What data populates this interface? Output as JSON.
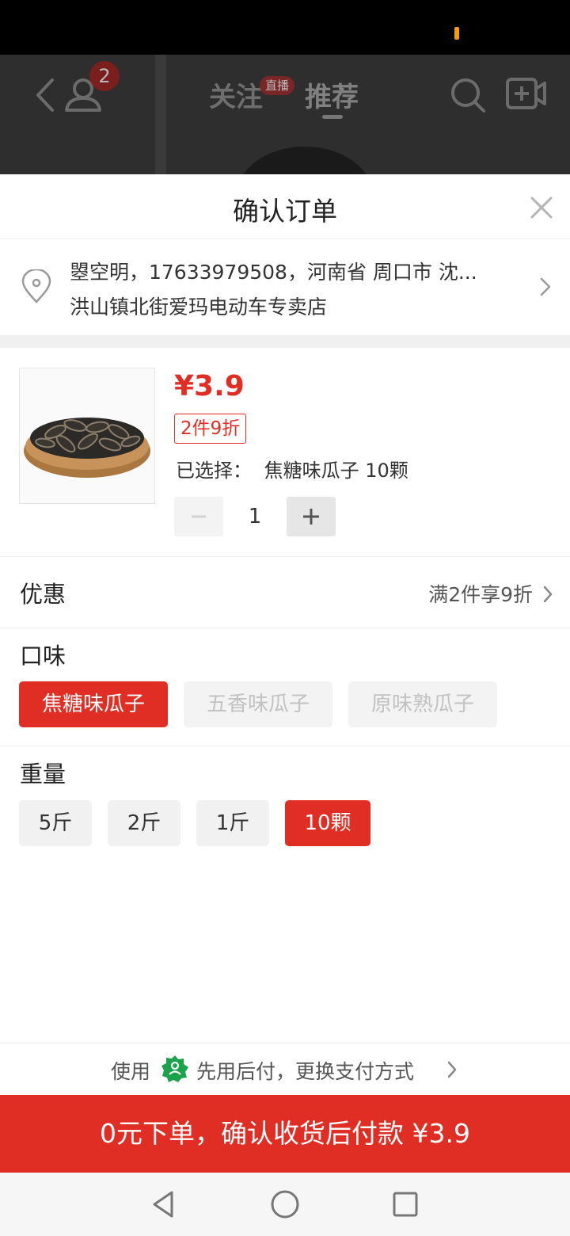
{
  "colors": {
    "accent": "#e02e24",
    "status_bar": "#000000"
  },
  "background_app": {
    "friend_badge_count": "2",
    "tabs": [
      {
        "label": "关注",
        "badge": "直播"
      },
      {
        "label": "推荐"
      }
    ],
    "icons": [
      "back-icon",
      "user-icon",
      "search-icon",
      "camera-add-icon"
    ]
  },
  "order_sheet": {
    "title": "确认订单",
    "close_icon": "close-icon",
    "address": {
      "line1": "曌空明，17633979508，河南省 周口市 沈...",
      "line2": "洪山镇北街爱玛电动车专卖店",
      "icon": "location-pin-icon"
    },
    "product": {
      "image": "sunflower-seeds-bowl",
      "price": "¥3.9",
      "promo_tag": "2件9折",
      "selected_label": "已选择：",
      "selected_value": "焦糖味瓜子 10颗",
      "quantity": "1",
      "minus_icon": "minus-icon",
      "plus_icon": "plus-icon"
    },
    "discount": {
      "label": "优惠",
      "value": "满2件享9折"
    },
    "flavor": {
      "title": "口味",
      "options": [
        {
          "label": "焦糖味瓜子",
          "state": "selected"
        },
        {
          "label": "五香味瓜子",
          "state": "disabled"
        },
        {
          "label": "原味熟瓜子",
          "state": "disabled"
        }
      ]
    },
    "weight": {
      "title": "重量",
      "options": [
        {
          "label": "5斤",
          "state": "normal"
        },
        {
          "label": "2斤",
          "state": "normal"
        },
        {
          "label": "1斤",
          "state": "normal"
        },
        {
          "label": "10颗",
          "state": "selected"
        }
      ]
    },
    "payment": {
      "prefix": "使用",
      "method": "先用后付，更换支付方式",
      "icon": "pay-later-badge-icon"
    },
    "submit_label": "0元下单，确认收货后付款 ¥3.9"
  },
  "nav_bar": {
    "icons": [
      "back-triangle-icon",
      "home-circle-icon",
      "recents-square-icon"
    ]
  }
}
